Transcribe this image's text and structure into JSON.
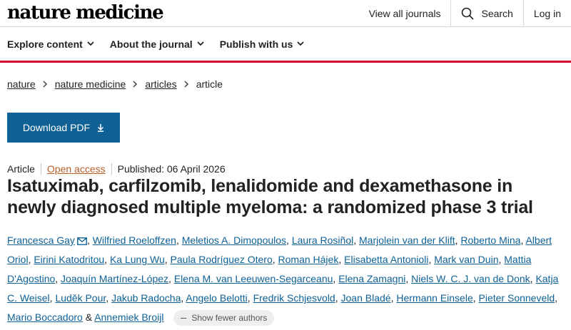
{
  "header": {
    "logo": "nature medicine",
    "view_all_journals": "View all journals",
    "search": "Search",
    "login": "Log in"
  },
  "subnav": {
    "items": [
      "Explore content",
      "About the journal",
      "Publish with us"
    ]
  },
  "breadcrumb": [
    "nature",
    "nature medicine",
    "articles",
    "article"
  ],
  "download_pdf": "Download PDF",
  "meta": {
    "type": "Article",
    "access": "Open access",
    "published": "Published: 06 April 2026"
  },
  "title": "Isatuximab, carfilzomib, lenalidomide and dexamethasone in newly diagnosed multiple myeloma: a randomized phase 3 trial",
  "authors": [
    "Francesca Gay",
    "Wilfried Roeloffzen",
    "Meletios A. Dimopoulos",
    "Laura Rosiñol",
    "Marjolein van der Klift",
    "Roberto Mina",
    "Albert Oriol",
    "Eirini Katodritou",
    "Ka Lung Wu",
    "Paula Rodríguez Otero",
    "Roman Hájek",
    "Elisabetta Antonioli",
    "Mark van Duin",
    "Mattia D'Agostino",
    "Joaquín Martínez-López",
    "Elena M. van Leeuwen-Segarceanu",
    "Elena Zamagni",
    "Niels W. C. J. van de Donk",
    "Katja C. Weisel",
    "Luděk Pour",
    "Jakub Radocha",
    "Angelo Belotti",
    "Fredrik Schjesvold",
    "Joan Bladé",
    "Hermann Einsele",
    "Pieter Sonneveld",
    "Mario Boccadoro",
    "Annemiek Broijl"
  ],
  "show_fewer_authors": "Show fewer authors",
  "colors": {
    "accent_red": "#d50032",
    "button_blue": "#0f6196",
    "open_access": "#b55e26"
  }
}
